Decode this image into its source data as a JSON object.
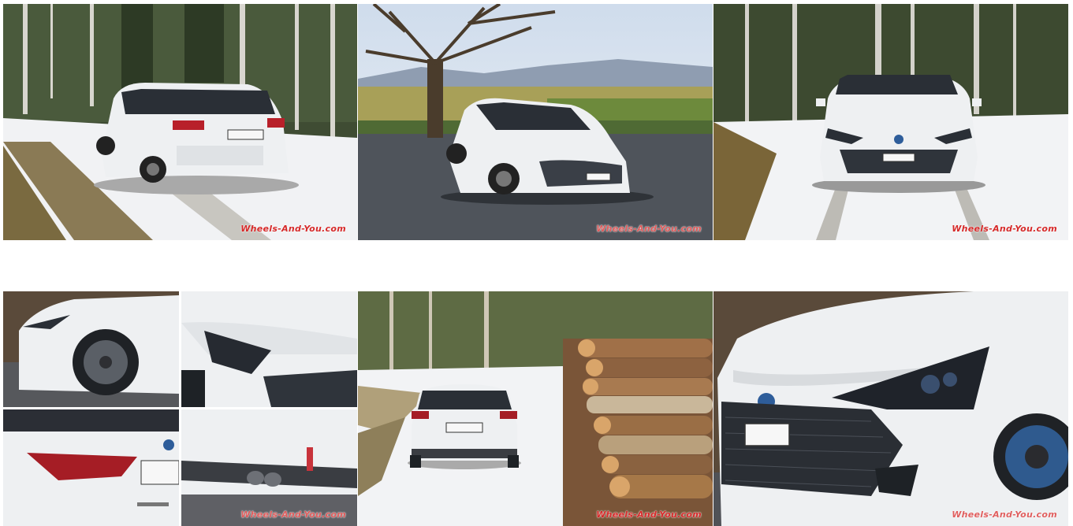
{
  "watermark_text": "Wheels-And-You.com",
  "photos": [
    {
      "id": "p1",
      "subject": "White Toyota Corolla Touring Sports rear view on snowy forest road"
    },
    {
      "id": "p2",
      "subject": "White Corolla front three-quarter view under large bare tree with mountain view"
    },
    {
      "id": "p3",
      "subject": "White Corolla front view on snowy forest road"
    },
    {
      "id": "p4a",
      "subject": "Close-up of front wheel and side"
    },
    {
      "id": "p4b",
      "subject": "Close-up of headlight"
    },
    {
      "id": "p4c",
      "subject": "Close-up of tail light and rear badge"
    },
    {
      "id": "p4d",
      "subject": "Close-up of rear bumper with dual exhaust"
    },
    {
      "id": "p5",
      "subject": "White Corolla rear view on snowy lane beside log pile"
    },
    {
      "id": "p6",
      "subject": "Close-up of front grille and headlight"
    }
  ],
  "colors": {
    "car_white": "#eef0f2",
    "snow": "#f3f4f6",
    "forest": "#3b4a2e",
    "watermark_red": "#d62a2a"
  }
}
